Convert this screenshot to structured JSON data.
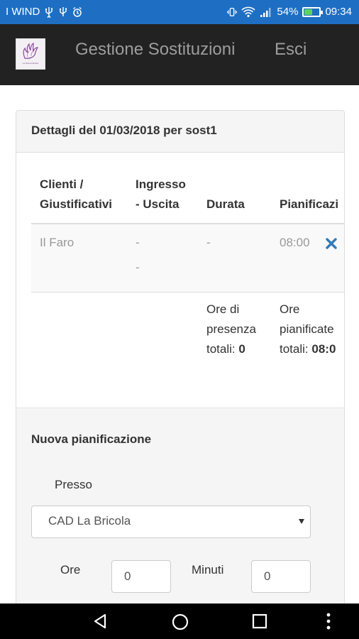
{
  "status_bar": {
    "carrier": "I WIND",
    "battery_percent": "54%",
    "battery_level": 0.54,
    "time": "09:34",
    "icons": [
      "usb-icon",
      "usb-icon",
      "alarm-icon",
      "vibrate-icon",
      "wifi-icon",
      "signal-icon",
      "battery-icon"
    ],
    "background": "#1e6fc3"
  },
  "header": {
    "logo_text": "La Nuova Sintesi",
    "title": "Gestione Sostituzioni",
    "exit_label": "Esci",
    "background": "#222222"
  },
  "panel": {
    "heading": "Dettagli del 01/03/2018 per sost1",
    "table": {
      "columns": [
        {
          "line1": "Clienti /",
          "line2": "Giustificativi"
        },
        {
          "line1": "Ingresso",
          "line2": "- Uscita"
        },
        {
          "line1": "Durata",
          "line2": ""
        },
        {
          "line1": "Pianificazi",
          "line2": ""
        }
      ],
      "rows": [
        {
          "cliente": "Il Faro",
          "ingresso": "-",
          "uscita": "-",
          "durata": "-",
          "pianificazione": "08:00",
          "delete_icon": "close-icon"
        }
      ],
      "totals": {
        "presenza_l1": "Ore di",
        "presenza_l2": "presenza",
        "presenza_l3": "totali:",
        "presenza_value": "0",
        "pianificate_l1": "Ore",
        "pianificate_l2": "pianificate",
        "pianificate_l3": "totali:",
        "pianificate_value": "08:0"
      }
    }
  },
  "new_plan": {
    "title": "Nuova pianificazione",
    "presso_label": "Presso",
    "presso_value": "CAD La Bricola",
    "ore_label": "Ore",
    "ore_value": "0",
    "minuti_label": "Minuti",
    "minuti_value": "0"
  },
  "accent_color": "#337ab7"
}
